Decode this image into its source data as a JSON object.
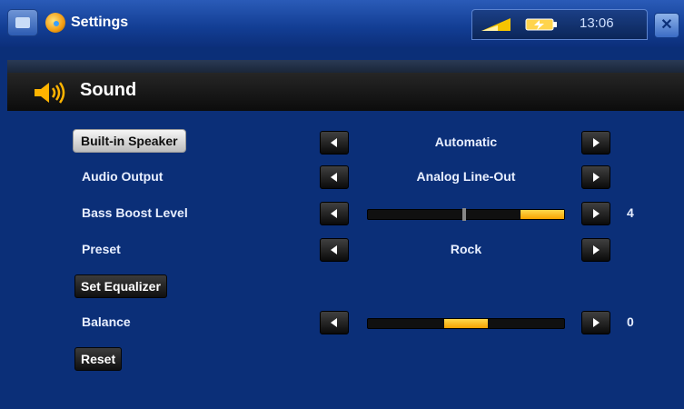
{
  "window": {
    "app_title": "Settings",
    "clock": "13:06",
    "icons": {
      "menu": "menu-icon",
      "app": "settings-icon",
      "wifi": "wifi-signal-icon",
      "battery": "battery-charging-icon",
      "close": "close-icon"
    }
  },
  "section": {
    "title": "Sound",
    "icon": "speaker-icon"
  },
  "settings": {
    "speaker": {
      "label": "Built-in Speaker",
      "value": "Automatic"
    },
    "audio_output": {
      "label": "Audio Output",
      "value": "Analog Line-Out"
    },
    "bass_boost": {
      "label": "Bass Boost Level",
      "value": "4",
      "level_fraction": 0.2
    },
    "preset": {
      "label": "Preset",
      "value": "Rock"
    },
    "equalizer": {
      "label": "Set Equalizer"
    },
    "balance": {
      "label": "Balance",
      "value": "0"
    },
    "reset": {
      "label": "Reset"
    }
  },
  "colors": {
    "background": "#0b2f78",
    "accent": "#f7a200",
    "section_bar": "#111111"
  }
}
